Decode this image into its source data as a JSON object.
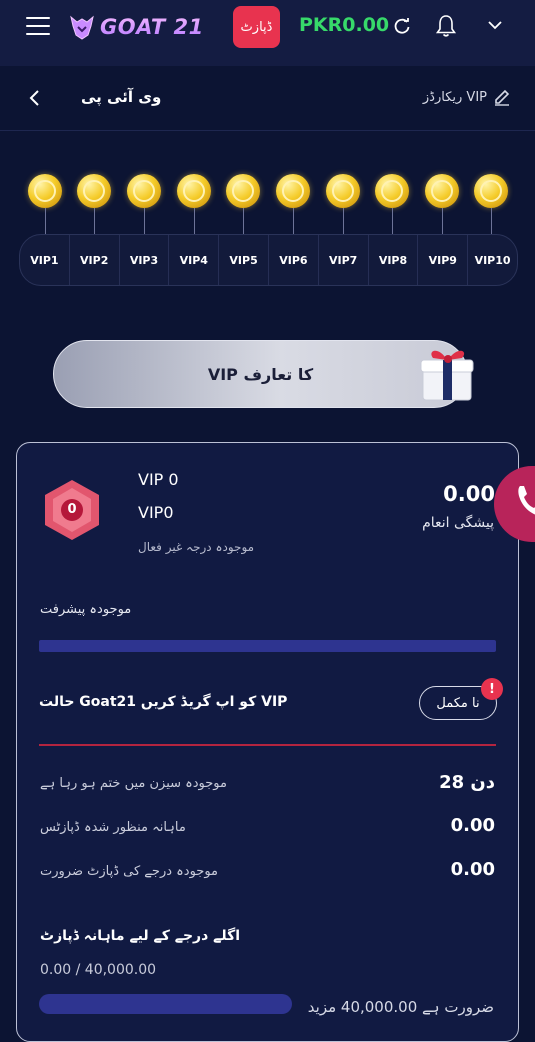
{
  "header": {
    "logo_text": "GOAT 21",
    "deposit_label": "ڈپازٹ",
    "balance": "PKR0.00"
  },
  "subheader": {
    "title": "وی آئی پی",
    "records_label": "ریکارڈز VIP"
  },
  "vip_levels": [
    "VIP1",
    "VIP2",
    "VIP3",
    "VIP4",
    "VIP5",
    "VIP6",
    "VIP7",
    "VIP8",
    "VIP9",
    "VIP10"
  ],
  "intro_button_label": "VIP کا تعارف",
  "status_card": {
    "hex_value": "0",
    "level_title": "VIP 0",
    "level_code": "VIP0",
    "status_text": "موجودہ درجہ غیر فعال",
    "advance_reward_value": "0.00",
    "advance_reward_label": "پیشگی انعام",
    "progress_label": "موجودہ پیشرفت",
    "progress_fraction": 0,
    "upgrade_text": "حالت Goat21 کو اپ گریڈ کریں VIP",
    "incomplete_label": "نا مکمل",
    "alert_glyph": "!",
    "season_label": "موجودہ سیزن میں ختم ہو رہا ہے",
    "season_value": "دن 28",
    "monthly_approved_label": "ماہانہ منظور شدہ ڈپازٹس",
    "monthly_approved_value": "0.00",
    "required_label": "موجودہ درجے کی ڈپازٹ ضرورت",
    "required_value": "0.00",
    "monthly_deposit_title": "اگلے درجے کے لیے ماہانہ ڈپازٹ",
    "monthly_progress_text": "0.00 / 40,000.00",
    "monthly_progress_fraction": 0,
    "needed_text": "ضرورت ہے 40,000.00 مزید"
  },
  "colors": {
    "background": "#0c1433",
    "accent_red": "#e8334f",
    "balance_green": "#37d96a",
    "progress_blue": "#2e3490"
  }
}
